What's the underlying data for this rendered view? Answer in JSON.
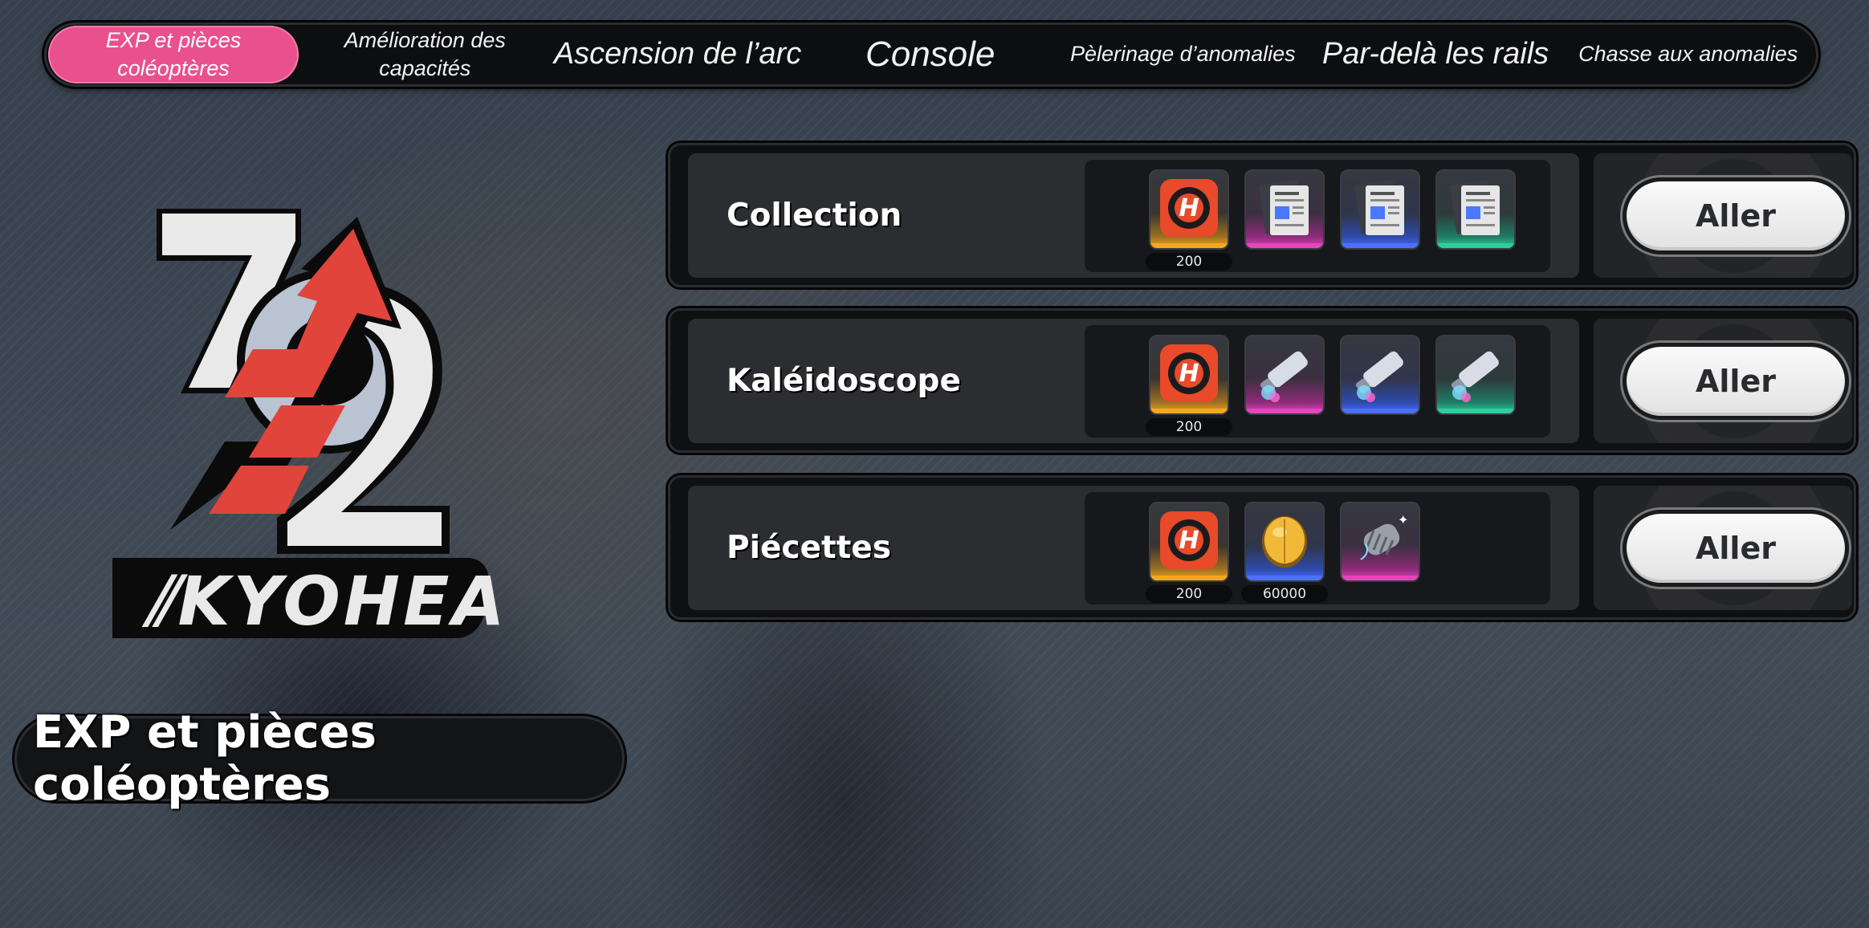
{
  "tabs": [
    {
      "label": "EXP et pièces coléoptères",
      "size": "small",
      "active": true
    },
    {
      "label": "Amélioration des capacités",
      "size": "small",
      "active": false
    },
    {
      "label": "Ascension de l’arc",
      "size": "large",
      "active": false
    },
    {
      "label": "Console",
      "size": "xlarge",
      "active": false
    },
    {
      "label": "Pèlerinage d’anomalies",
      "size": "small",
      "active": false
    },
    {
      "label": "Par-delà les rails",
      "size": "large",
      "active": false
    },
    {
      "label": "Chasse aux anomalies",
      "size": "small",
      "active": false
    }
  ],
  "logo_text": "72 ⟪KYOHEA",
  "section_title": "EXP et pièces coléoptères",
  "rows": [
    {
      "label": "Collection",
      "button": "Aller",
      "rewards": [
        {
          "icon": "hunter-badge-icon",
          "quality": "gold",
          "qty": "200"
        },
        {
          "icon": "document-files-icon",
          "quality": "pink",
          "qty": ""
        },
        {
          "icon": "document-files-icon",
          "quality": "blue",
          "qty": ""
        },
        {
          "icon": "document-files-icon",
          "quality": "teal",
          "qty": ""
        }
      ]
    },
    {
      "label": "Kaléidoscope",
      "button": "Aller",
      "rewards": [
        {
          "icon": "hunter-badge-icon",
          "quality": "gold",
          "qty": "200"
        },
        {
          "icon": "paint-tube-icon",
          "quality": "pink",
          "qty": ""
        },
        {
          "icon": "paint-tube-icon",
          "quality": "blue",
          "qty": ""
        },
        {
          "icon": "paint-tube-icon",
          "quality": "teal",
          "qty": ""
        }
      ]
    },
    {
      "label": "Piécettes",
      "button": "Aller",
      "rewards": [
        {
          "icon": "hunter-badge-icon",
          "quality": "gold",
          "qty": "200"
        },
        {
          "icon": "beetle-coin-icon",
          "quality": "blue",
          "qty": "60000"
        },
        {
          "icon": "spring-coil-icon",
          "quality": "pink",
          "qty": ""
        }
      ]
    }
  ]
}
